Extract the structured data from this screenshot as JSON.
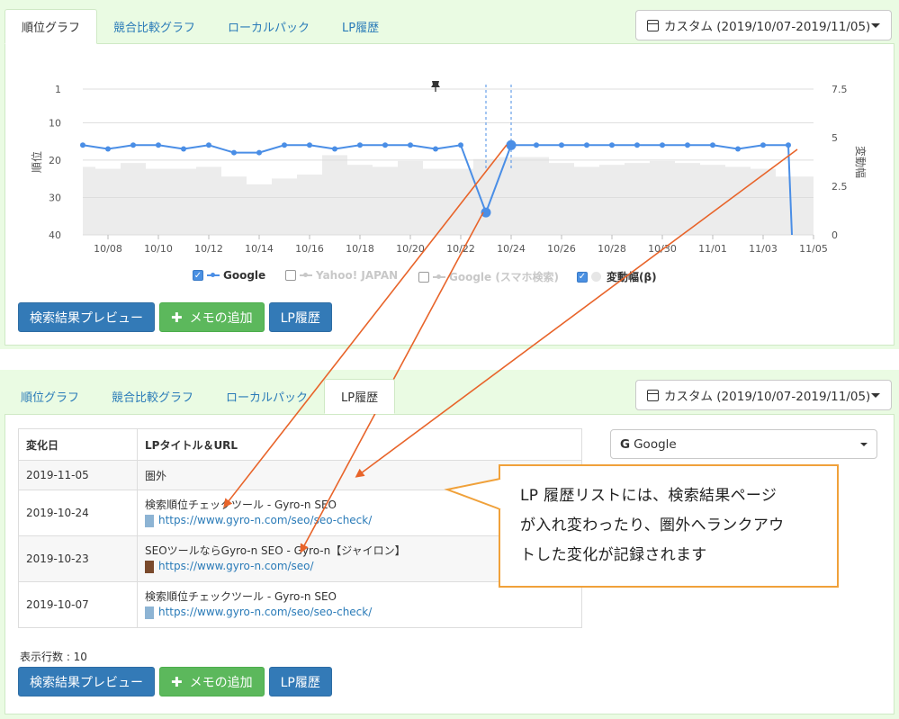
{
  "top": {
    "tabs": [
      {
        "label": "順位グラフ",
        "active": true
      },
      {
        "label": "競合比較グラフ",
        "active": false
      },
      {
        "label": "ローカルパック",
        "active": false
      },
      {
        "label": "LP履歴",
        "active": false
      }
    ],
    "date_range": "カスタム (2019/10/07-2019/11/05)",
    "buttons": {
      "preview": "検索結果プレビュー",
      "add_memo": "メモの追加",
      "lp_history": "LP履歴"
    }
  },
  "chart_data": {
    "type": "line",
    "x": [
      "10/07",
      "10/08",
      "10/09",
      "10/10",
      "10/11",
      "10/12",
      "10/13",
      "10/14",
      "10/15",
      "10/16",
      "10/17",
      "10/18",
      "10/19",
      "10/20",
      "10/21",
      "10/22",
      "10/23",
      "10/24",
      "10/25",
      "10/26",
      "10/27",
      "10/28",
      "10/29",
      "10/30",
      "10/31",
      "11/01",
      "11/02",
      "11/03",
      "11/04",
      "11/05"
    ],
    "x_ticks": [
      "10/08",
      "10/10",
      "10/12",
      "10/14",
      "10/16",
      "10/18",
      "10/20",
      "10/22",
      "10/24",
      "10/26",
      "10/28",
      "10/30",
      "11/01",
      "11/03",
      "11/05"
    ],
    "series": [
      {
        "name": "Google",
        "axis": "left",
        "color": "#4a8ee6",
        "values": [
          16,
          17,
          16,
          16,
          17,
          16,
          18,
          18,
          16,
          16,
          17,
          16,
          16,
          16,
          17,
          16,
          34,
          16,
          16,
          16,
          16,
          16,
          16,
          16,
          16,
          16,
          17,
          16,
          16,
          null
        ]
      },
      {
        "name": "変動幅(β)",
        "axis": "right",
        "color": "#ececec",
        "type": "area",
        "values": [
          3.5,
          3.4,
          3.7,
          3.4,
          3.4,
          3.5,
          3.0,
          2.6,
          2.9,
          3.1,
          4.1,
          3.6,
          3.5,
          3.8,
          3.4,
          3.4,
          3.9,
          4.0,
          4.0,
          3.7,
          3.5,
          3.6,
          3.7,
          3.8,
          3.7,
          3.6,
          3.5,
          3.4,
          3.0,
          3.0
        ]
      }
    ],
    "ylabel": "順位",
    "ylabel_right": "変動幅",
    "y_ticks": [
      "1",
      "10",
      "20",
      "30",
      "40"
    ],
    "ylim": [
      1,
      40
    ],
    "y_inverted": true,
    "y2_ticks": [
      "7.5",
      "5",
      "2.5",
      "0"
    ],
    "y2lim": [
      0,
      7.5
    ],
    "markers": [
      {
        "x": "10/21",
        "type": "pin"
      }
    ],
    "dashed_vlines": [
      "10/23",
      "10/24"
    ],
    "highlight_points": [
      "10/23",
      "10/24"
    ],
    "legend": [
      {
        "label": "Google",
        "checked": true,
        "color": "#4a8ee6"
      },
      {
        "label": "Yahoo! JAPAN",
        "checked": false,
        "color": "#c8c8c8"
      },
      {
        "label": "Google (スマホ検索)",
        "checked": false,
        "color": "#c8c8c8"
      },
      {
        "label": "変動幅(β)",
        "checked": true,
        "color": "#d8d8d8"
      }
    ],
    "grid": true,
    "legend_position": "bottom"
  },
  "bottom": {
    "tabs": [
      {
        "label": "順位グラフ",
        "active": false
      },
      {
        "label": "競合比較グラフ",
        "active": false
      },
      {
        "label": "ローカルパック",
        "active": false
      },
      {
        "label": "LP履歴",
        "active": true
      }
    ],
    "date_range": "カスタム (2019/10/07-2019/11/05)",
    "engine_select": "Google",
    "table": {
      "headers": [
        "変化日",
        "LPタイトル＆URL"
      ],
      "rows": [
        {
          "date": "2019-11-05",
          "title": "圏外",
          "url": "",
          "color": ""
        },
        {
          "date": "2019-10-24",
          "title": "検索順位チェックツール - Gyro-n SEO",
          "url": "https://www.gyro-n.com/seo/seo-check/",
          "color": "#8db4d4"
        },
        {
          "date": "2019-10-23",
          "title": "SEOツールならGyro-n SEO - Gyro-n【ジャイロン】",
          "url": "https://www.gyro-n.com/seo/",
          "color": "#7a4a2c"
        },
        {
          "date": "2019-10-07",
          "title": "検索順位チェックツール - Gyro-n SEO",
          "url": "https://www.gyro-n.com/seo/seo-check/",
          "color": "#8db4d4"
        }
      ]
    },
    "row_count": "表示行数 : 10",
    "buttons": {
      "preview": "検索結果プレビュー",
      "add_memo": "メモの追加",
      "lp_history": "LP履歴"
    }
  },
  "callout": {
    "text_lines": [
      "LP 履歴リストには、検索結果ページ",
      "が入れ変わったり、圏外へランクアウ",
      "トした変化が記録されます"
    ],
    "border_color": "#f0a13a"
  },
  "annotation_arrow_color": "#e8642a"
}
